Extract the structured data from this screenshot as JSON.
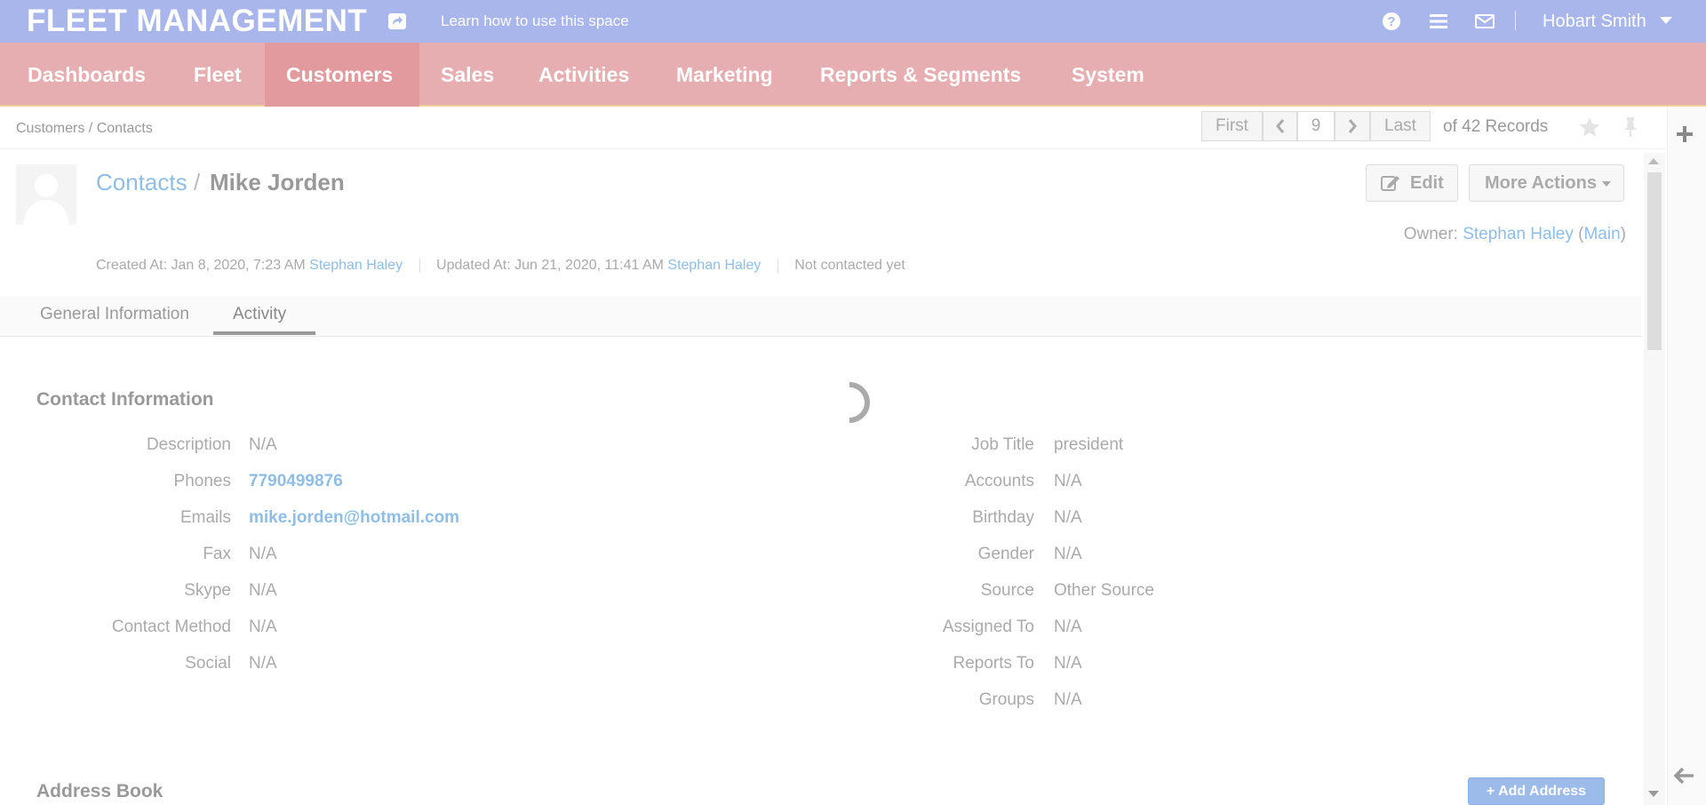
{
  "topbar": {
    "brand": "FLEET MANAGEMENT",
    "learn_link": "Learn how to use this space",
    "user_name": "Hobart Smith",
    "icons": [
      "share-icon",
      "help-icon",
      "list-icon",
      "mail-icon"
    ]
  },
  "nav": {
    "items": [
      {
        "label": "Dashboards"
      },
      {
        "label": "Fleet"
      },
      {
        "label": "Customers"
      },
      {
        "label": "Sales"
      },
      {
        "label": "Activities"
      },
      {
        "label": "Marketing"
      },
      {
        "label": "Reports & Segments"
      },
      {
        "label": "System"
      }
    ],
    "active": "Customers"
  },
  "breadcrumb": "Customers / Contacts",
  "pagination": {
    "first": "First",
    "current": "9",
    "last": "Last",
    "records": "of 42 Records"
  },
  "record": {
    "section_link": "Contacts",
    "separator": "/",
    "name": "Mike Jorden",
    "edit_label": "Edit",
    "more_actions_label": "More Actions",
    "owner_label": "Owner:",
    "owner_name": "Stephan Haley",
    "owner_unit": "Main",
    "created_label": "Created At: Jan 8, 2020, 7:23 AM",
    "created_by": "Stephan Haley",
    "updated_label": "Updated At: Jun 21, 2020, 11:41 AM",
    "updated_by": "Stephan Haley",
    "contact_status": "Not contacted yet"
  },
  "tabs": [
    {
      "label": "General Information",
      "active": false
    },
    {
      "label": "Activity",
      "active": true
    }
  ],
  "contact_info": {
    "title": "Contact Information",
    "left": [
      {
        "label": "Description",
        "value": "N/A"
      },
      {
        "label": "Phones",
        "value": "7790499876"
      },
      {
        "label": "Emails",
        "value": "mike.jorden@hotmail.com"
      },
      {
        "label": "Fax",
        "value": "N/A"
      },
      {
        "label": "Skype",
        "value": "N/A"
      },
      {
        "label": "Contact Method",
        "value": "N/A"
      },
      {
        "label": "Social",
        "value": "N/A"
      }
    ],
    "right": [
      {
        "label": "Job Title",
        "value": "president"
      },
      {
        "label": "Accounts",
        "value": "N/A"
      },
      {
        "label": "Birthday",
        "value": "N/A"
      },
      {
        "label": "Gender",
        "value": "N/A"
      },
      {
        "label": "Source",
        "value": "Other Source"
      },
      {
        "label": "Assigned To",
        "value": "N/A"
      },
      {
        "label": "Reports To",
        "value": "N/A"
      },
      {
        "label": "Groups",
        "value": "N/A"
      }
    ]
  },
  "address_book": {
    "title": "Address Book",
    "add_label": "+ Add Address"
  },
  "colors": {
    "topbar": "#a8b6ec",
    "nav": "#e6aeb1",
    "nav_active": "#e39a9e",
    "link": "#8fbde6",
    "add_button": "#9cbbea"
  }
}
